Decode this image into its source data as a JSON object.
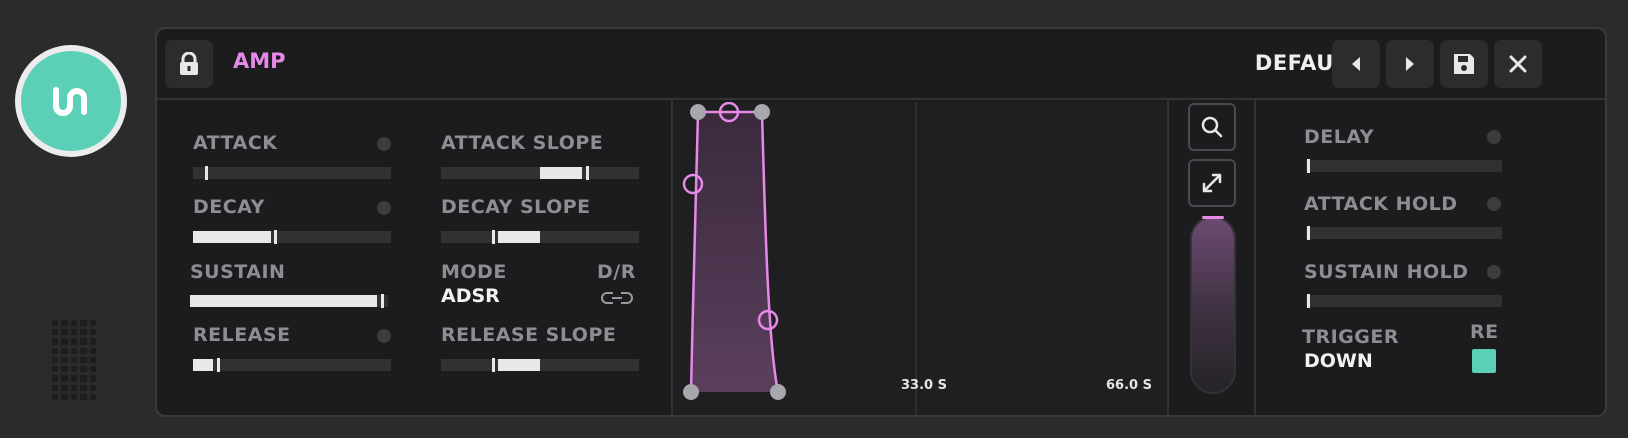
{
  "header": {
    "title": "AMP",
    "preset": "DEFAULT"
  },
  "icons": {
    "logo": "logo-icon",
    "lock": "lock-icon",
    "prev": "chevron-left-icon",
    "next": "chevron-right-icon",
    "save": "save-icon",
    "close": "close-icon",
    "zoom": "zoom-icon",
    "expand": "expand-icon",
    "link": "link-icon"
  },
  "colors": {
    "accent": "#e689e8",
    "teal": "#5ccfb7",
    "panel": "#1c1c1e"
  },
  "left": {
    "attack": {
      "label": "ATTACK",
      "value": 0.06
    },
    "decay": {
      "label": "DECAY",
      "value": 0.41
    },
    "sustain": {
      "label": "SUSTAIN",
      "value": 0.98
    },
    "release": {
      "label": "RELEASE",
      "value": 0.13
    }
  },
  "middle": {
    "attack_slope": {
      "label": "ATTACK SLOPE",
      "value": 0.75
    },
    "decay_slope": {
      "label": "DECAY SLOPE",
      "value": 0.27
    },
    "mode_label": "MODE",
    "mode_value": "ADSR",
    "dr_label": "D/R",
    "release_slope": {
      "label": "RELEASE SLOPE",
      "value": 0.27
    }
  },
  "graph": {
    "time_marks": [
      "33.0 S",
      "66.0 S"
    ]
  },
  "right": {
    "delay": {
      "label": "DELAY",
      "value": 0.0
    },
    "attack_hold": {
      "label": "ATTACK HOLD",
      "value": 0.0
    },
    "sustain_hold": {
      "label": "SUSTAIN HOLD",
      "value": 0.0
    },
    "trigger_label": "TRIGGER",
    "trigger_value": "DOWN",
    "re_label": "RE",
    "re_enabled": true
  }
}
